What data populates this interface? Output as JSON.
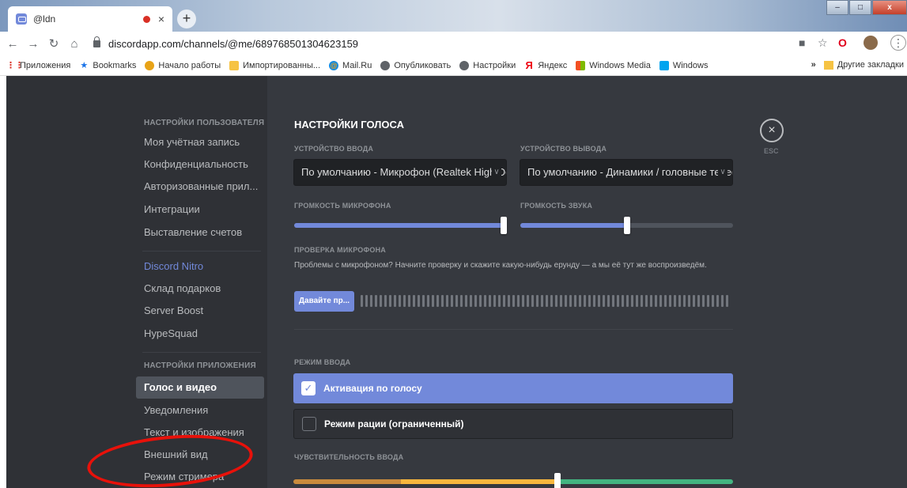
{
  "browser": {
    "tab_title": "@ldn",
    "tab_close": "×",
    "new_tab": "+",
    "url": "discordapp.com/channels/@me/689768501304623159",
    "bookmarks": [
      {
        "label": "Приложения",
        "icon": "apps-grid-icon"
      },
      {
        "label": "Bookmarks",
        "icon": "star-icon"
      },
      {
        "label": "Начало работы",
        "icon": "chrome-icon"
      },
      {
        "label": "Импортированны...",
        "icon": "folder-icon"
      },
      {
        "label": "Mail.Ru",
        "icon": "mailru-icon"
      },
      {
        "label": "Опубликовать",
        "icon": "globe-icon"
      },
      {
        "label": "Настройки",
        "icon": "globe-icon"
      },
      {
        "label": "Яндекс",
        "icon": "yandex-icon"
      },
      {
        "label": "Windows Media",
        "icon": "windows-icon"
      },
      {
        "label": "Windows",
        "icon": "windows-icon"
      }
    ],
    "more_bookmarks": "»",
    "other_bookmarks": "Другие закладки"
  },
  "sidebar": {
    "user_settings_header": "НАСТРОЙКИ ПОЛЬЗОВАТЕЛЯ",
    "user_items": [
      "Моя учётная запись",
      "Конфиденциальность",
      "Авторизованные прил...",
      "Интеграции",
      "Выставление счетов"
    ],
    "nitro_items": [
      "Discord Nitro",
      "Склад подарков",
      "Server Boost",
      "HypeSquad"
    ],
    "app_settings_header": "НАСТРОЙКИ ПРИЛОЖЕНИЯ",
    "app_items": [
      "Голос и видео",
      "Уведомления",
      "Текст и изображения",
      "Внешний вид",
      "Режим стримера"
    ]
  },
  "voice": {
    "title": "НАСТРОЙКИ ГОЛОСА",
    "input_device_label": "УСТРОЙСТВО ВВОДА",
    "input_device_value": "По умолчанию - Микрофон (Realtek High Definition Audio)",
    "output_device_label": "УСТРОЙСТВО ВЫВОДА",
    "output_device_value": "По умолчанию - Динамики / головные телефоны",
    "mic_volume_label": "ГРОМКОСТЬ МИКРОФОНА",
    "mic_volume_fraction": 0.99,
    "output_volume_label": "ГРОМКОСТЬ ЗВУКА",
    "output_volume_fraction": 0.5,
    "mic_test_label": "ПРОВЕРКА МИКРОФОНА",
    "mic_test_desc": "Проблемы с микрофоном? Начните проверку и скажите какую-нибудь ерунду — а мы её тут же воспроизведём.",
    "mic_test_button": "Давайте пр...",
    "input_mode_label": "РЕЖИМ ВВОДА",
    "mode_voice_activity": "Активация по голосу",
    "mode_ptt": "Режим рации (ограниченный)",
    "sensitivity_label": "ЧУВСТВИТЕЛЬНОСТЬ ВВОДА",
    "sensitivity_fraction": 0.6,
    "esc_label": "ESC",
    "close_glyph": "×"
  },
  "colors": {
    "blurple": "#7289da",
    "sens_red": "#c98b3d",
    "sens_yellow": "#f8b73e",
    "sens_green": "#43b581",
    "annotation_red": "#e8110a"
  }
}
